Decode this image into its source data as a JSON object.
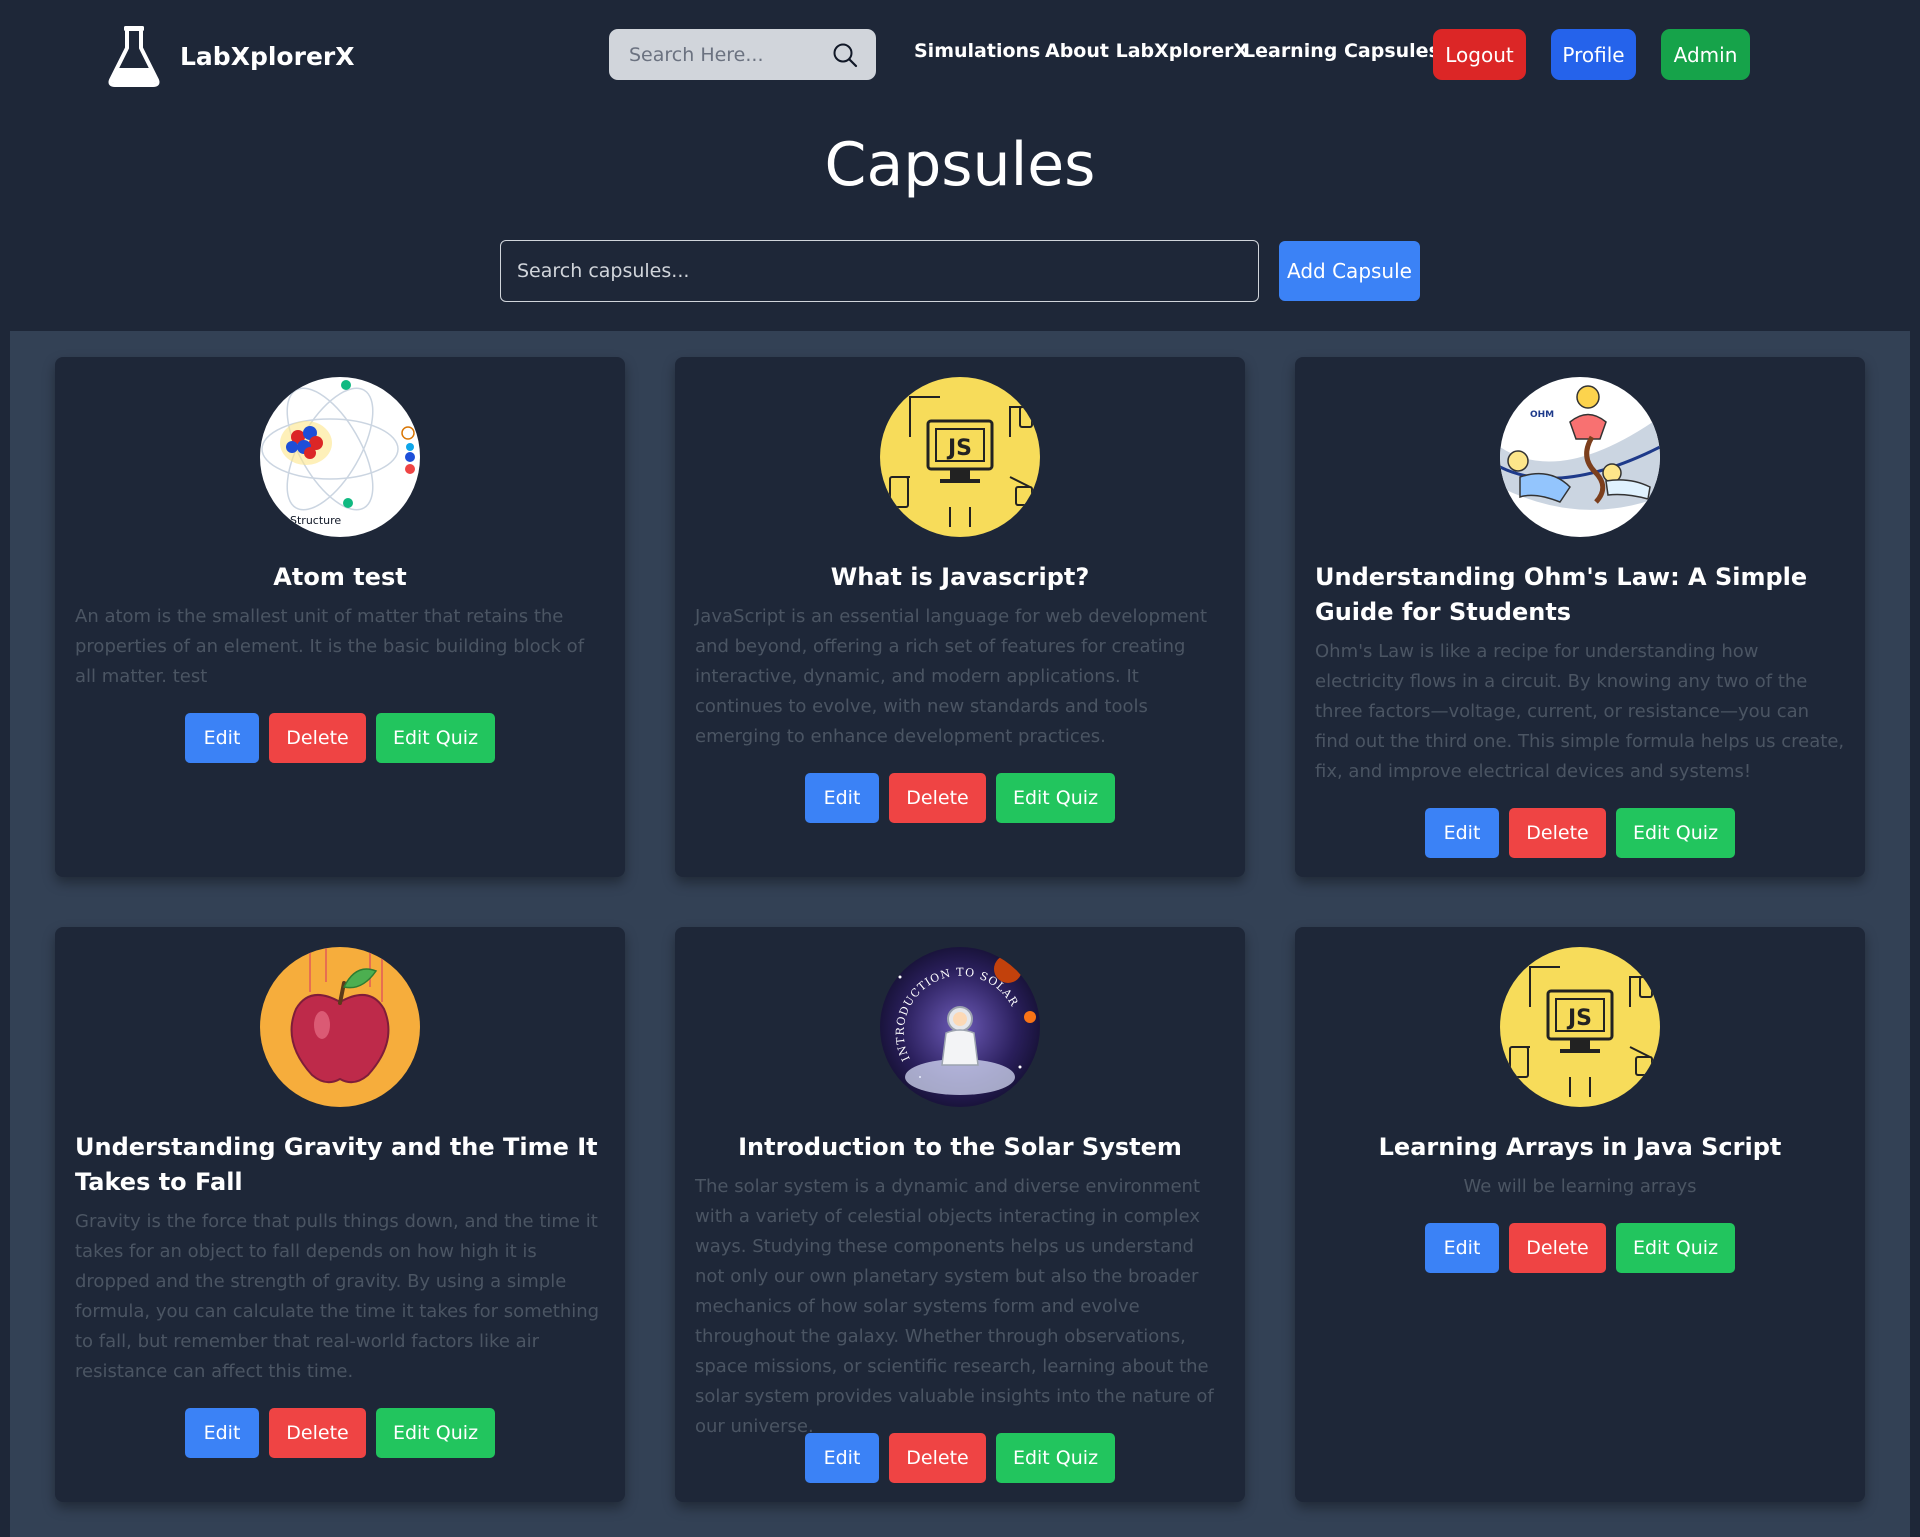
{
  "brand": {
    "name": "LabXplorerX"
  },
  "nav": {
    "search_placeholder": "Search Here...",
    "links": [
      "Simulations",
      "About LabXplorerX",
      "Learning Capsules"
    ],
    "logout": "Logout",
    "profile": "Profile",
    "admin": "Admin"
  },
  "colors": {
    "logout": "#dc2626",
    "profile": "#2563eb",
    "admin": "#16a34a",
    "edit": "#3b82f6",
    "delete": "#ef4444",
    "quiz": "#22c55e"
  },
  "page": {
    "title": "Capsules",
    "search_placeholder": "Search capsules...",
    "add_button": "Add Capsule"
  },
  "card_buttons": {
    "edit": "Edit",
    "delete": "Delete",
    "quiz": "Edit Quiz"
  },
  "capsules": [
    {
      "title": "Atom test",
      "description": "An atom is the smallest unit of matter that retains the properties of an element. It is the basic building block of all matter. test",
      "image_icon": "atom-structure-icon",
      "image_caption": "Structure"
    },
    {
      "title": "What is Javascript?",
      "description": "JavaScript is an essential language for web development and beyond, offering a rich set of features for creating interactive, dynamic, and modern applications. It continues to evolve, with new standards and tools emerging to enhance development practices.",
      "image_icon": "javascript-logo-icon",
      "image_caption": "JS"
    },
    {
      "title": "Understanding Ohm's Law: A Simple Guide for Students",
      "description": "Ohm's Law is like a recipe for understanding how electricity flows in a circuit. By knowing any two of the three factors—voltage, current, or resistance—you can find out the third one. This simple formula helps us create, fix, and improve electrical devices and systems!",
      "image_icon": "ohms-law-cartoon-icon",
      "image_caption": "OHM"
    },
    {
      "title": "Understanding Gravity and the Time It Takes to Fall",
      "description": "Gravity is the force that pulls things down, and the time it takes for an object to fall depends on how high it is dropped and the strength of gravity. By using a simple formula, you can calculate the time it takes for something to fall, but remember that real-world factors like air resistance can affect this time.",
      "image_icon": "falling-apple-icon"
    },
    {
      "title": "Introduction to the Solar System",
      "description": "The solar system is a dynamic and diverse environment with a variety of celestial objects interacting in complex ways. Studying these components helps us understand not only our own planetary system but also the broader mechanics of how solar systems form and evolve throughout the galaxy. Whether through observations, space missions, or scientific research, learning about the solar system provides valuable insights into the nature of our universe.",
      "image_icon": "astronaut-space-icon",
      "image_caption": "INTRODUCTION TO SOLAR SYSTEM"
    },
    {
      "title": "Learning Arrays in Java Script",
      "description": "We will be learning arrays",
      "image_icon": "javascript-logo-icon",
      "image_caption": "JS"
    }
  ]
}
